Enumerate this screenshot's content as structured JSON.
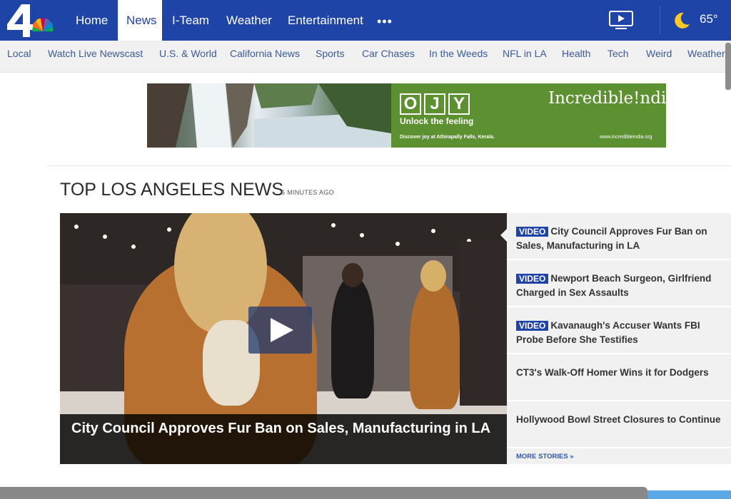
{
  "nav": {
    "items": [
      {
        "label": "Home"
      },
      {
        "label": "News"
      },
      {
        "label": "I-Team"
      },
      {
        "label": "Weather"
      },
      {
        "label": "Entertainment"
      }
    ],
    "more_label": "•••",
    "temperature": "65°",
    "active": "News"
  },
  "subnav": {
    "items": [
      {
        "label": "Local"
      },
      {
        "label": "Watch Live Newscast"
      },
      {
        "label": "U.S. & World"
      },
      {
        "label": "California News"
      },
      {
        "label": "Sports"
      },
      {
        "label": "Car Chases"
      },
      {
        "label": "In the Weeds"
      },
      {
        "label": "NFL in LA"
      },
      {
        "label": "Health"
      },
      {
        "label": "Tech"
      },
      {
        "label": "Weird"
      },
      {
        "label": "Weather"
      }
    ]
  },
  "ad": {
    "letters": [
      "O",
      "J",
      "Y"
    ],
    "tagline": "Unlock the feeling",
    "small_text": "Discover joy at Athirapally Falls, Kerala.",
    "brand": "Incredible!ndia",
    "url": "www.incredibleindia.org"
  },
  "section": {
    "title": "TOP LOS ANGELES NEWS",
    "time": "6 MINUTES AGO"
  },
  "hero": {
    "caption": "City Council Approves Fur Ban on Sales, Manufacturing in LA"
  },
  "stories": {
    "items": [
      {
        "badge": "VIDEO",
        "title": "City Council Approves Fur Ban on Sales, Manufacturing in LA"
      },
      {
        "badge": "VIDEO",
        "title": "Newport Beach Surgeon, Girlfriend Charged in Sex Assaults"
      },
      {
        "badge": "VIDEO",
        "title": "Kavanaugh's Accuser Wants FBI Probe Before She Testifies"
      },
      {
        "badge": "",
        "title": "CT3's Walk-Off Homer Wins it for Dodgers"
      },
      {
        "badge": "",
        "title": "Hollywood Bowl Street Closures to Continue"
      }
    ],
    "more_label": "MORE STORIES »"
  },
  "colors": {
    "brand_blue": "#1e44a8",
    "link_blue": "#3a5a9c",
    "ad_green": "#5c9030"
  }
}
